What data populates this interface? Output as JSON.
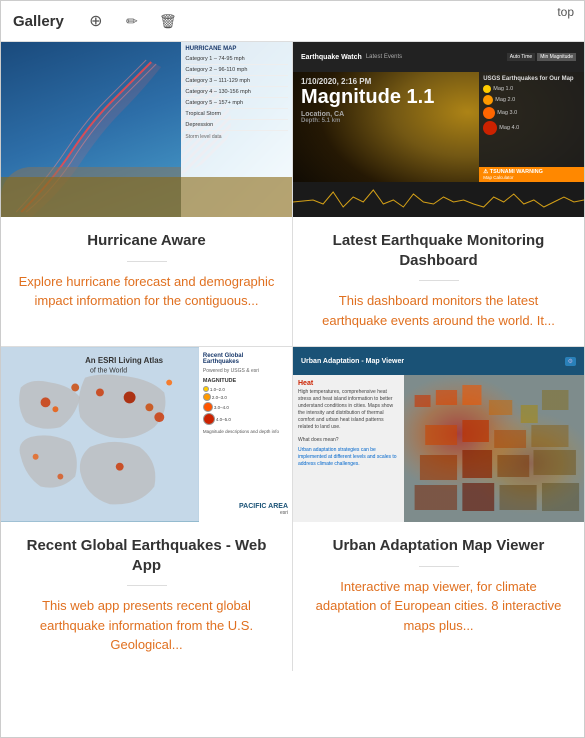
{
  "top_label": "top",
  "toolbar": {
    "title": "Gallery",
    "add_icon": "⊕",
    "edit_icon": "✏",
    "delete_icon": "🗑"
  },
  "items": [
    {
      "id": "hurricane-aware",
      "title": "Hurricane Aware",
      "description": "Explore hurricane forecast and demographic impact information for the contiguous...",
      "thumbnail_type": "hurricane"
    },
    {
      "id": "latest-earthquake",
      "title": "Latest Earthquake Monitoring Dashboard",
      "description": "This dashboard monitors the latest earthquake events around the world. It...",
      "thumbnail_type": "earthquake",
      "thumbnail_date": "1/10/2020, 2:16 PM",
      "thumbnail_magnitude": "Magnitude 1.1"
    },
    {
      "id": "recent-global-earthquakes",
      "title": "Recent Global Earthquakes - Web App",
      "description": "This web app presents recent global earthquake information from the U.S. Geological...",
      "thumbnail_type": "global-eq"
    },
    {
      "id": "urban-adaptation",
      "title": "Urban Adaptation Map Viewer",
      "description": "Interactive map viewer, for climate adaptation of European cities. 8 interactive maps plus...",
      "thumbnail_type": "urban"
    }
  ],
  "hurricane_details": [
    "Category 1",
    "Category 2",
    "Category 3",
    "Category 4",
    "Category 5",
    "Tropical Storm",
    "Tropical Depression"
  ],
  "eq_legend": [
    "Magnitude 1.0",
    "Magnitude 2.0",
    "Magnitude 3.0",
    "Magnitude 4.0"
  ]
}
